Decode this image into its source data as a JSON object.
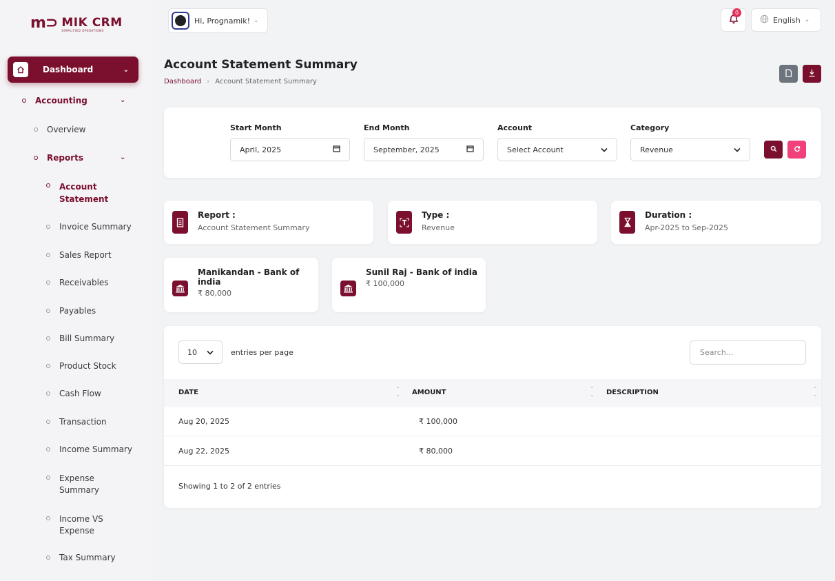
{
  "logo": {
    "mark": "m⊃",
    "name": "MIK CRM",
    "tagline": "SIMPLIFIED OPERATIONS"
  },
  "sidebar": {
    "dashboard": "Dashboard",
    "accounting": "Accounting",
    "overview": "Overview",
    "reports": "Reports",
    "items": [
      "Account Statement",
      "Invoice Summary",
      "Sales Report",
      "Receivables",
      "Payables",
      "Bill Summary",
      "Product Stock",
      "Cash Flow",
      "Transaction",
      "Income Summary",
      "Expense Summary",
      "Income VS Expense",
      "Tax Summary"
    ]
  },
  "header": {
    "greeting": "Hi, Prognamik!",
    "notification_count": "0",
    "language": "English"
  },
  "page": {
    "title": "Account Statement Summary",
    "breadcrumb": [
      "Dashboard",
      "Account Statement Summary"
    ]
  },
  "filters": {
    "start_month": {
      "label": "Start Month",
      "value": "April, 2025"
    },
    "end_month": {
      "label": "End Month",
      "value": "September, 2025"
    },
    "account": {
      "label": "Account",
      "value": "Select Account"
    },
    "category": {
      "label": "Category",
      "value": "Revenue"
    }
  },
  "info": {
    "report": {
      "label": "Report :",
      "value": "Account Statement Summary"
    },
    "type": {
      "label": "Type :",
      "value": "Revenue"
    },
    "duration": {
      "label": "Duration :",
      "value": "Apr-2025 to Sep-2025"
    }
  },
  "banks": [
    {
      "name": "Manikandan - Bank of india",
      "amount": "₹ 80,000"
    },
    {
      "name": "Sunil Raj - Bank of india",
      "amount": "₹ 100,000"
    }
  ],
  "table": {
    "entries_value": "10",
    "entries_label": "entries per page",
    "search_placeholder": "Search...",
    "columns": [
      "DATE",
      "AMOUNT",
      "DESCRIPTION"
    ],
    "rows": [
      {
        "date": "Aug 20, 2025",
        "amount": "₹ 100,000",
        "description": ""
      },
      {
        "date": "Aug 22, 2025",
        "amount": "₹ 80,000",
        "description": ""
      }
    ],
    "footer": "Showing 1 to 2 of 2 entries"
  },
  "colors": {
    "brand": "#7a0f2e",
    "accent_pink": "#f0417a"
  }
}
